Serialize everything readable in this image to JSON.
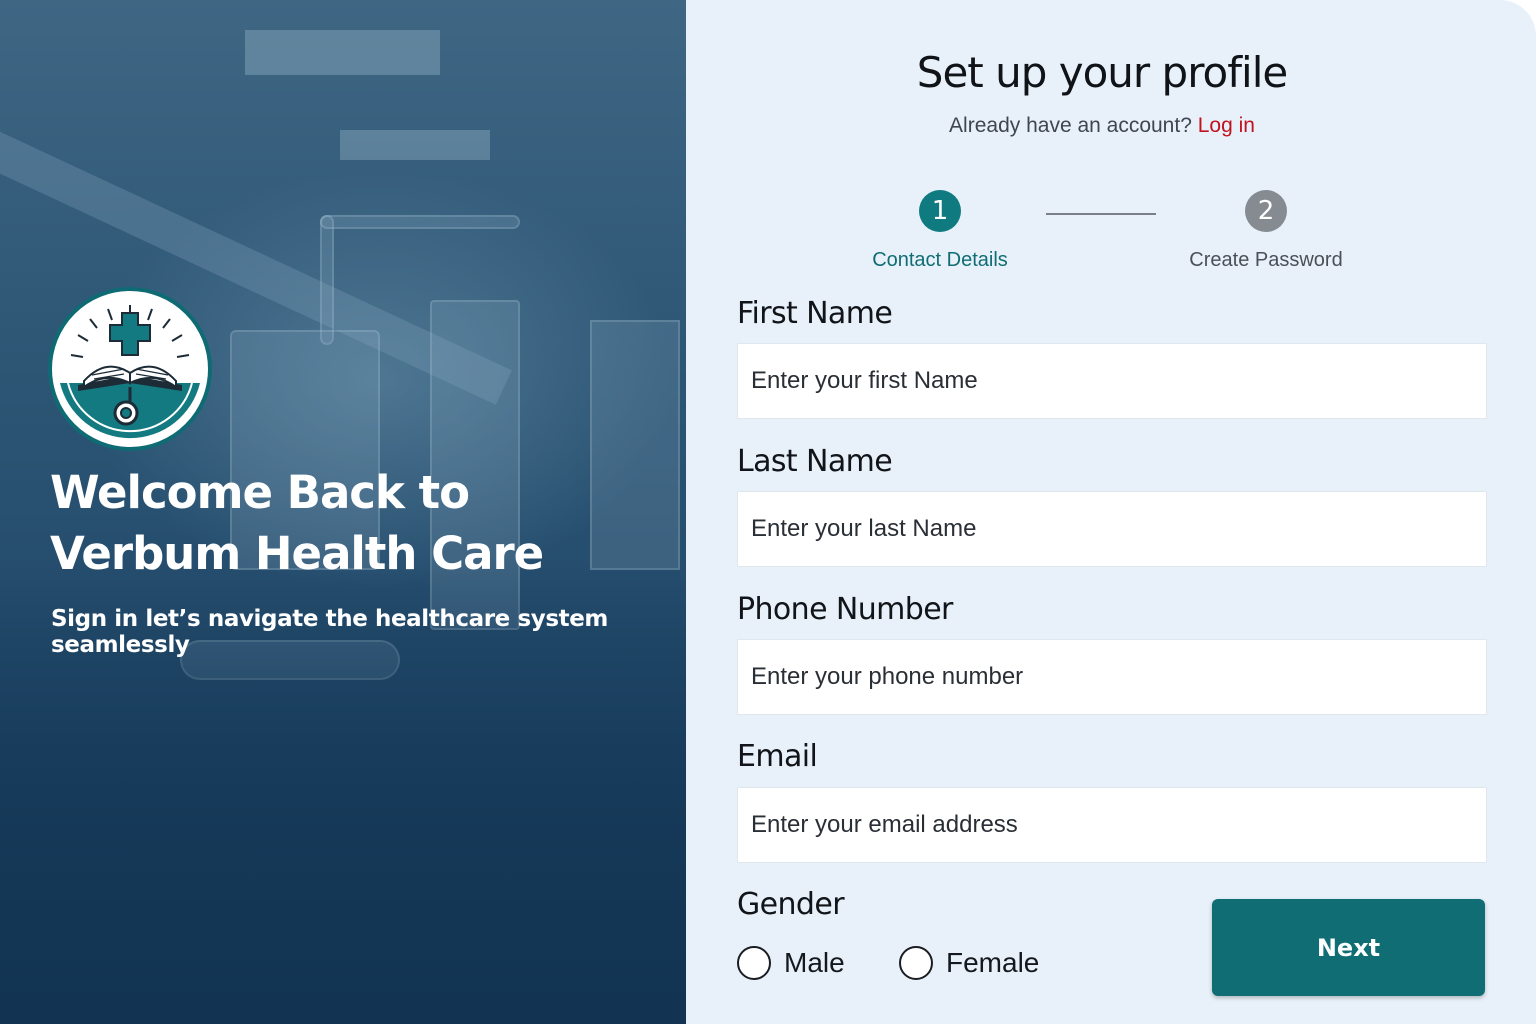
{
  "hero": {
    "title_line1": "Welcome Back to",
    "title_line2": "Verbum Health Care",
    "subtitle": "Sign in let’s navigate the healthcare system seamlessly",
    "logo_icon": "book-cross-stethoscope-icon"
  },
  "form": {
    "title": "Set up your profile",
    "login_prompt": "Already have an account?",
    "login_link": "Log in",
    "steps": [
      {
        "number": "1",
        "label": "Contact Details",
        "state": "active"
      },
      {
        "number": "2",
        "label": "Create Password",
        "state": "inactive"
      }
    ],
    "fields": {
      "first_name": {
        "label": "First Name",
        "placeholder": "Enter your first Name",
        "value": ""
      },
      "last_name": {
        "label": "Last Name",
        "placeholder": "Enter your last Name",
        "value": ""
      },
      "phone": {
        "label": "Phone Number",
        "placeholder": "Enter your phone number",
        "value": ""
      },
      "email": {
        "label": "Email",
        "placeholder": "Enter your email address",
        "value": ""
      }
    },
    "gender": {
      "label": "Gender",
      "options": [
        "Male",
        "Female"
      ],
      "selected": null
    },
    "next_label": "Next"
  },
  "colors": {
    "accent": "#0f6d73",
    "step_active": "#0f7a80",
    "step_inactive": "#858b91",
    "link": "#c0121f",
    "panel_bg": "#e8f1fa",
    "hero_bg": "#22496a"
  }
}
